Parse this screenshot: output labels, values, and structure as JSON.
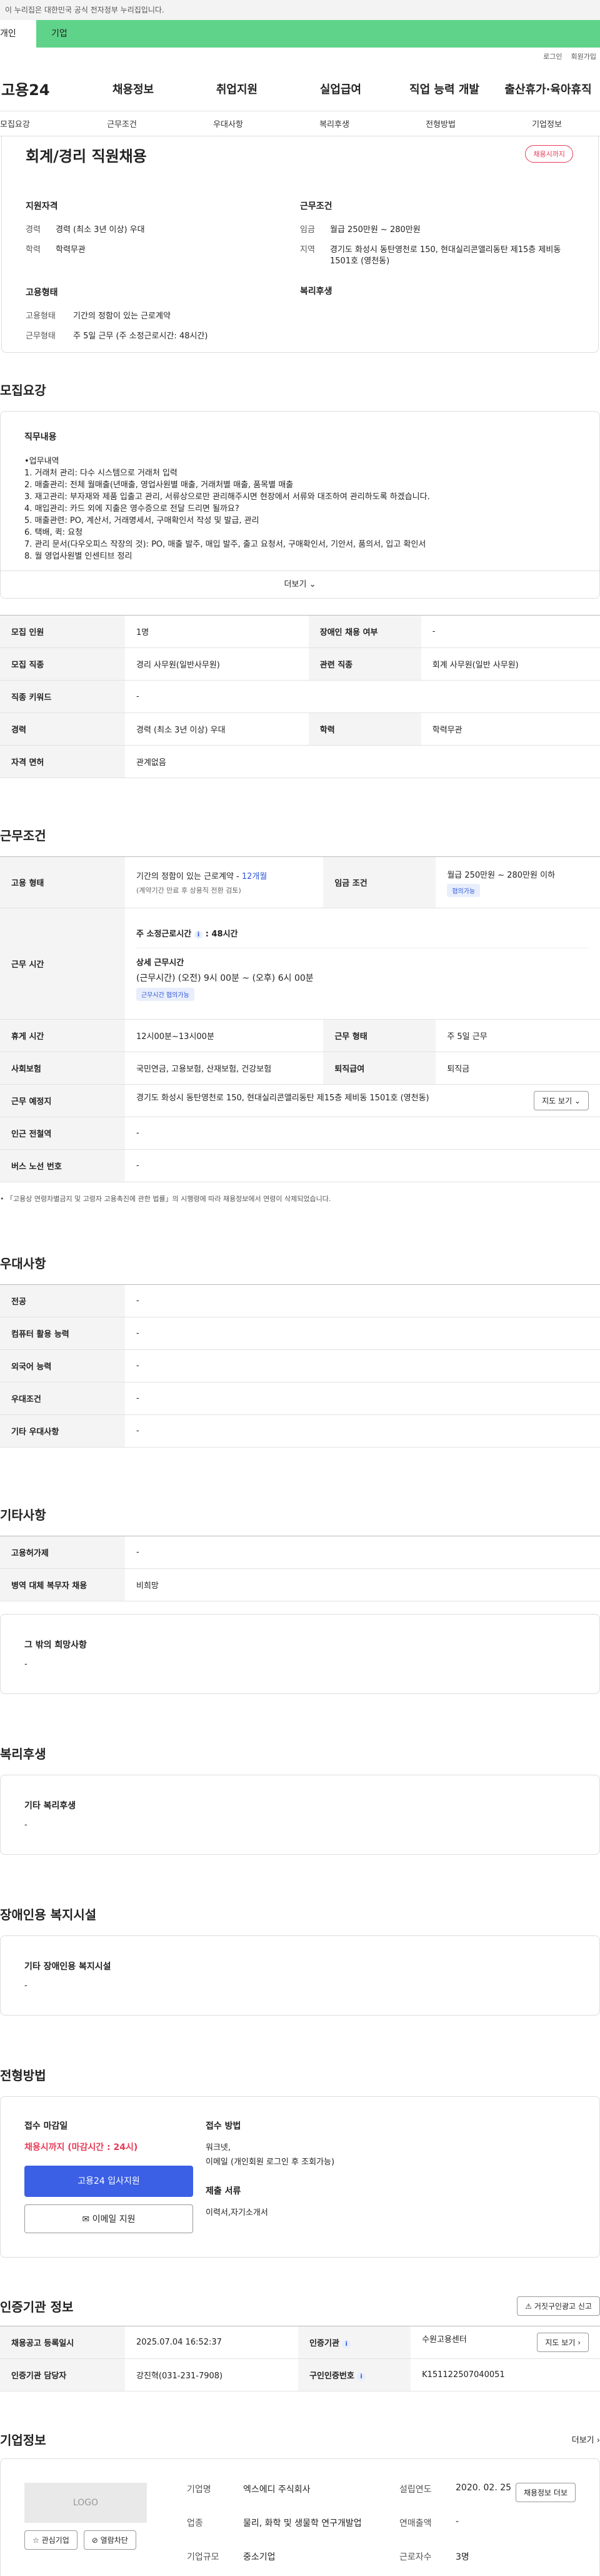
{
  "gov_banner": "이 누리집은 대한민국 공식 전자정부 누리집입니다.",
  "top_tabs": [
    "개인",
    "기업"
  ],
  "util": [
    "로그인",
    "회원가입"
  ],
  "logo": "고용24",
  "gnb": [
    "채용정보",
    "취업지원",
    "실업급여",
    "직업 능력 개발",
    "출산휴가·육아휴직"
  ],
  "subnav": [
    "모집요강",
    "근무조건",
    "우대사항",
    "복리후생",
    "전형방법",
    "기업정보"
  ],
  "summary": {
    "title": "회계/경리 직원채용",
    "badge": "채용시까지",
    "qual_head": "지원자격",
    "qual": [
      {
        "k": "경력",
        "v": "경력 (최소 3년 이상) 우대"
      },
      {
        "k": "학력",
        "v": "학력무관"
      }
    ],
    "emp_head": "고용형태",
    "emp": [
      {
        "k": "고용형태",
        "v": "기간의 정함이 있는 근로계약"
      },
      {
        "k": "근무형태",
        "v": "주 5일 근무 (주 소정근로시간: 48시간)"
      }
    ],
    "cond_head": "근무조건",
    "cond": [
      {
        "k": "임금",
        "v": "월급 250만원 ~ 280만원"
      },
      {
        "k": "지역",
        "v": "경기도 화성시 동탄영천로 150, 현대실리콘앨리동탄 제15층 제비동 1501호 (영천동)"
      }
    ],
    "welfare_head": "복리후생"
  },
  "recruit": {
    "heading": "모집요강",
    "duty_title": "직무내용",
    "duty_lines": [
      "•업무내역",
      "1.  거래처 관리: 다수 시스템으로 거래처 입력",
      "2.  매출관리: 전체 월매출(년매출, 영업사원별 매출, 거래처별 매출, 품목별 매출",
      "3.  재고관리: 부자재와 제품 입출고 관리, 서류상으로만 관리해주시면 현장에서 서류와 대조하여 관리하도록 하겠습니다.",
      "4.  매입관리: 카드 외에 지출은 영수증으로 전달 드리면 될까요?",
      "5.  매출관련: PO, 계산서, 거래명세서, 구매확인서 작성 및 발급, 관리",
      "6.  택배, 퀵: 요청",
      "7.  관리 문서(다우오피스 작장의 것): PO, 매출 발주, 매입 발주, 출고 요청서, 구매확인서, 기안서, 품의서, 입고 확인서",
      "8.  월 영업사원별 인센티브 정리"
    ],
    "more": "더보기",
    "rows": [
      [
        "모집 인원",
        "1명",
        "장애인 채용 여부",
        "-"
      ],
      [
        "모집 직종",
        "경리 사무원(일반사무원)",
        "관련 직종",
        "회계 사무원(일반 사무원)"
      ],
      [
        "직종 키워드",
        "-",
        "",
        ""
      ],
      [
        "경력",
        "경력 (최소 3년 이상) 우대",
        "학력",
        "학력무관"
      ],
      [
        "자격 면허",
        "관계없음",
        "",
        ""
      ]
    ]
  },
  "work": {
    "heading": "근무조건",
    "emp_k": "고용 형태",
    "emp_v": "기간의 정함이 있는 근로계약 - ",
    "emp_month": "12개월",
    "emp_sub": "(계약기간 만료 후 상용직 전환 검토)",
    "wage_k": "임금 조건",
    "wage_v": "월급 250만원 ~ 280만원 이하",
    "wage_chip": "협의가능",
    "time_k": "근무 시간",
    "time_week": "주 소정근로시간",
    "time_hours": "48시간",
    "time_detail_h": "상세 근무시간",
    "time_detail": "(근무시간) (오전) 9시 00분 ~ (오후) 6시 00분",
    "time_chip": "근무시간 협의가능",
    "rows": [
      [
        "휴게 시간",
        "12시00분~13시00분",
        "근무 형태",
        "주 5일 근무"
      ],
      [
        "사회보험",
        "국민연금, 고용보험, 산재보험, 건강보험",
        "퇴직급여",
        "퇴직금"
      ]
    ],
    "place_k": "근무 예정지",
    "place_v": "경기도 화성시 동탄영천로 150, 현대실리콘앨리동탄 제15층 제비동 1501호 (영천동)",
    "map_btn": "지도 보기",
    "station_k": "인근 전철역",
    "station_v": "-",
    "bus_k": "버스 노선 번호",
    "bus_v": "-",
    "note": "「고용상 연령차별금지 및 고령자 고용촉진에 관한 법률」의 시행령에 따라 채용정보에서 연령이 삭제되었습니다."
  },
  "pref": {
    "heading": "우대사항",
    "rows": [
      [
        "전공",
        "-"
      ],
      [
        "컴퓨터 활용 능력",
        "-"
      ],
      [
        "외국어 능력",
        "-"
      ],
      [
        "우대조건",
        "-"
      ],
      [
        "기타 우대사항",
        "-"
      ]
    ]
  },
  "etc": {
    "heading": "기타사항",
    "rows": [
      [
        "고용허가제",
        "-"
      ],
      [
        "병역 대체 복무자 채용",
        "비희망"
      ]
    ],
    "box_title": "그 밖의 희망사항",
    "box_val": "-"
  },
  "welfare": {
    "heading": "복리후생",
    "box_title": "기타 복리후생",
    "box_val": "-"
  },
  "disabled": {
    "heading": "장애인용 복지시설",
    "box_title": "기타 장애인용 복지시설",
    "box_val": "-"
  },
  "apply": {
    "heading": "전형방법",
    "deadline_t": "접수 마감일",
    "deadline": "채용시까지 (마감시간 : 24시)",
    "btn1": "고용24 입사지원",
    "btn2": "이메일 지원",
    "method_t": "접수 방법",
    "method1": "워크넷,",
    "method2": "이메일 (개인회원 로그인 후 조회가능)",
    "docs_t": "제출 서류",
    "docs": "이력서,자기소개서"
  },
  "cert": {
    "heading": "인증기관 정보",
    "report_btn": "거짓구인광고 신고",
    "rows": [
      [
        "채용공고 등록일시",
        "2025.07.04 16:52:37",
        "인증기관",
        "수원고용센터"
      ],
      [
        "인증기관 담당자",
        "강진혁(031-231-7908)",
        "구인인증번호",
        "K151122507040051"
      ]
    ],
    "map_btn": "지도 보기"
  },
  "company": {
    "heading": "기업정보",
    "more": "더보기",
    "logo": "LOGO",
    "fav": "관심기업",
    "block": "열람차단",
    "k1": "기업명",
    "v1": "엑스에디 주식회사",
    "k2": "업종",
    "v2": "물리, 화학 및 생물학 연구개발업",
    "k3": "기업규모",
    "v3": "중소기업",
    "k4": "설립연도",
    "v4": "2020. 02. 25",
    "k5": "연매출액",
    "v5": "-",
    "k6": "근로자수",
    "v6": "3명",
    "list_btn": "채용정보 더보"
  }
}
